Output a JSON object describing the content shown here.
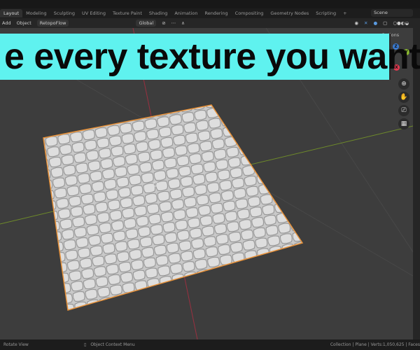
{
  "workspace_tabs": [
    "Layout",
    "Modeling",
    "Sculpting",
    "UV Editing",
    "Texture Paint",
    "Shading",
    "Animation",
    "Rendering",
    "Compositing",
    "Geometry Nodes",
    "Scripting",
    "+"
  ],
  "active_tab": "Layout",
  "scene": "Scene",
  "header": {
    "add": "Add",
    "object": "Object",
    "addon": "RetopoFlow",
    "orientation": "Global",
    "options": "Options"
  },
  "caption": "e every texture you want",
  "gizmo": {
    "x": "X",
    "y": "Y",
    "z": "Z"
  },
  "status": {
    "left": "Rotate View",
    "middle": "Object Context Menu",
    "right": "Collection | Plane | Verts:1,050,625 | Faces"
  },
  "colors": {
    "caption_bg": "#5ff2ef",
    "selection": "#e8923a",
    "x_axis": "#c0304a",
    "y_axis": "#7a9a2a"
  }
}
